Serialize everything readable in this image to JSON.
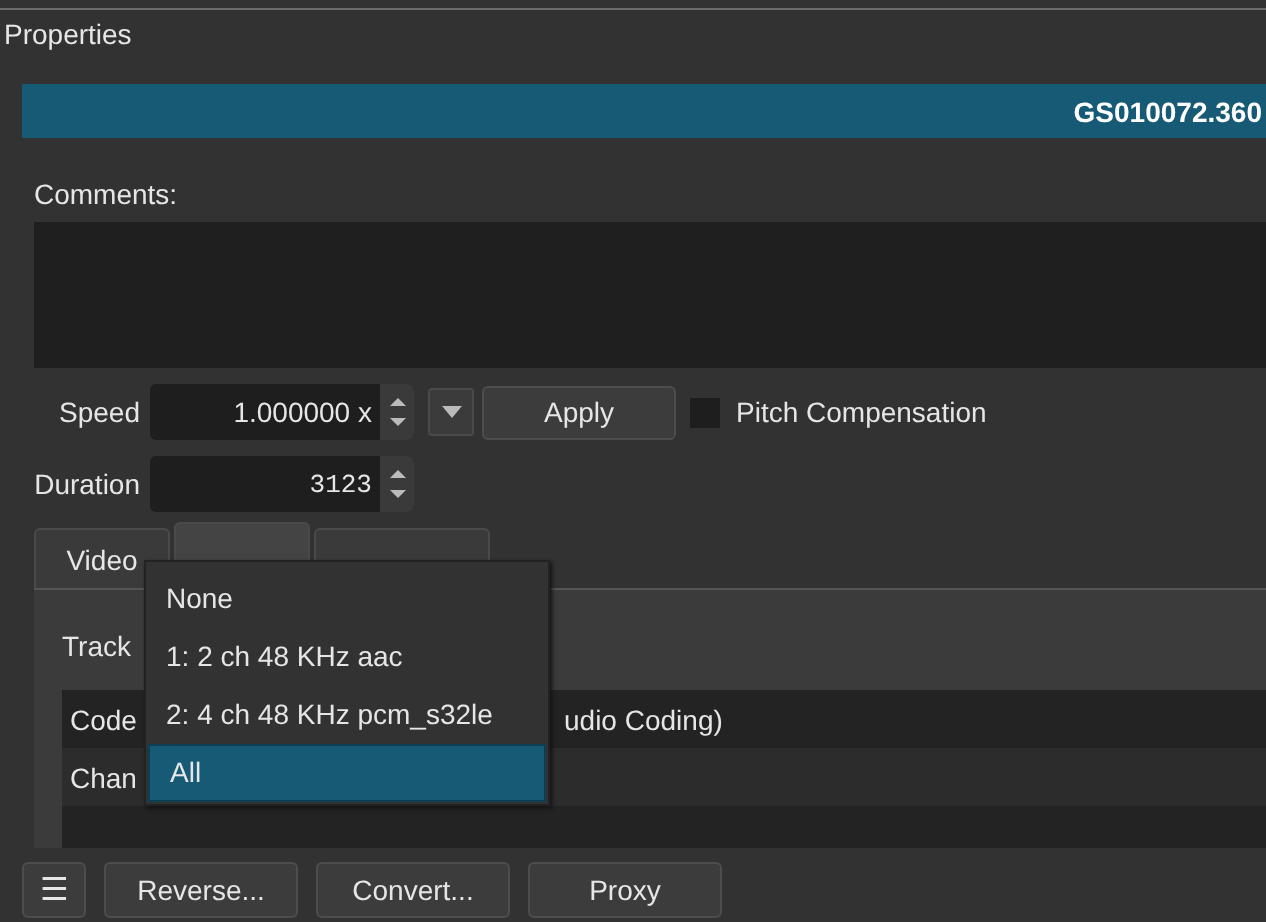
{
  "panel": {
    "title": "Properties"
  },
  "clip_name": "GS010072.360",
  "comments": {
    "label": "Comments:"
  },
  "speed": {
    "label": "Speed",
    "value": "1.000000 x",
    "apply": "Apply",
    "pitch_compensation": {
      "label": "Pitch Compensation",
      "checked": false
    }
  },
  "duration": {
    "label": "Duration",
    "value": "3123"
  },
  "tabs": [
    {
      "label": "Video",
      "selected": false
    },
    {
      "selected": true
    },
    {
      "selected": false
    }
  ],
  "track": {
    "label": "Track"
  },
  "table": {
    "rows": [
      {
        "label": "Code",
        "value": "udio Coding)"
      },
      {
        "label": "Chan"
      },
      {}
    ]
  },
  "track_menu": {
    "items": [
      {
        "label": "None",
        "selected": false
      },
      {
        "label": "1: 2 ch 48 KHz aac",
        "selected": false
      },
      {
        "label": "2: 4 ch 48 KHz pcm_s32le",
        "selected": false
      },
      {
        "label": "All",
        "selected": true
      }
    ]
  },
  "buttons": [
    {
      "kind": "menu",
      "label": "☰"
    },
    {
      "kind": "text",
      "label": "Reverse..."
    },
    {
      "kind": "text",
      "label": "Convert..."
    },
    {
      "kind": "text",
      "label": "Proxy"
    }
  ]
}
